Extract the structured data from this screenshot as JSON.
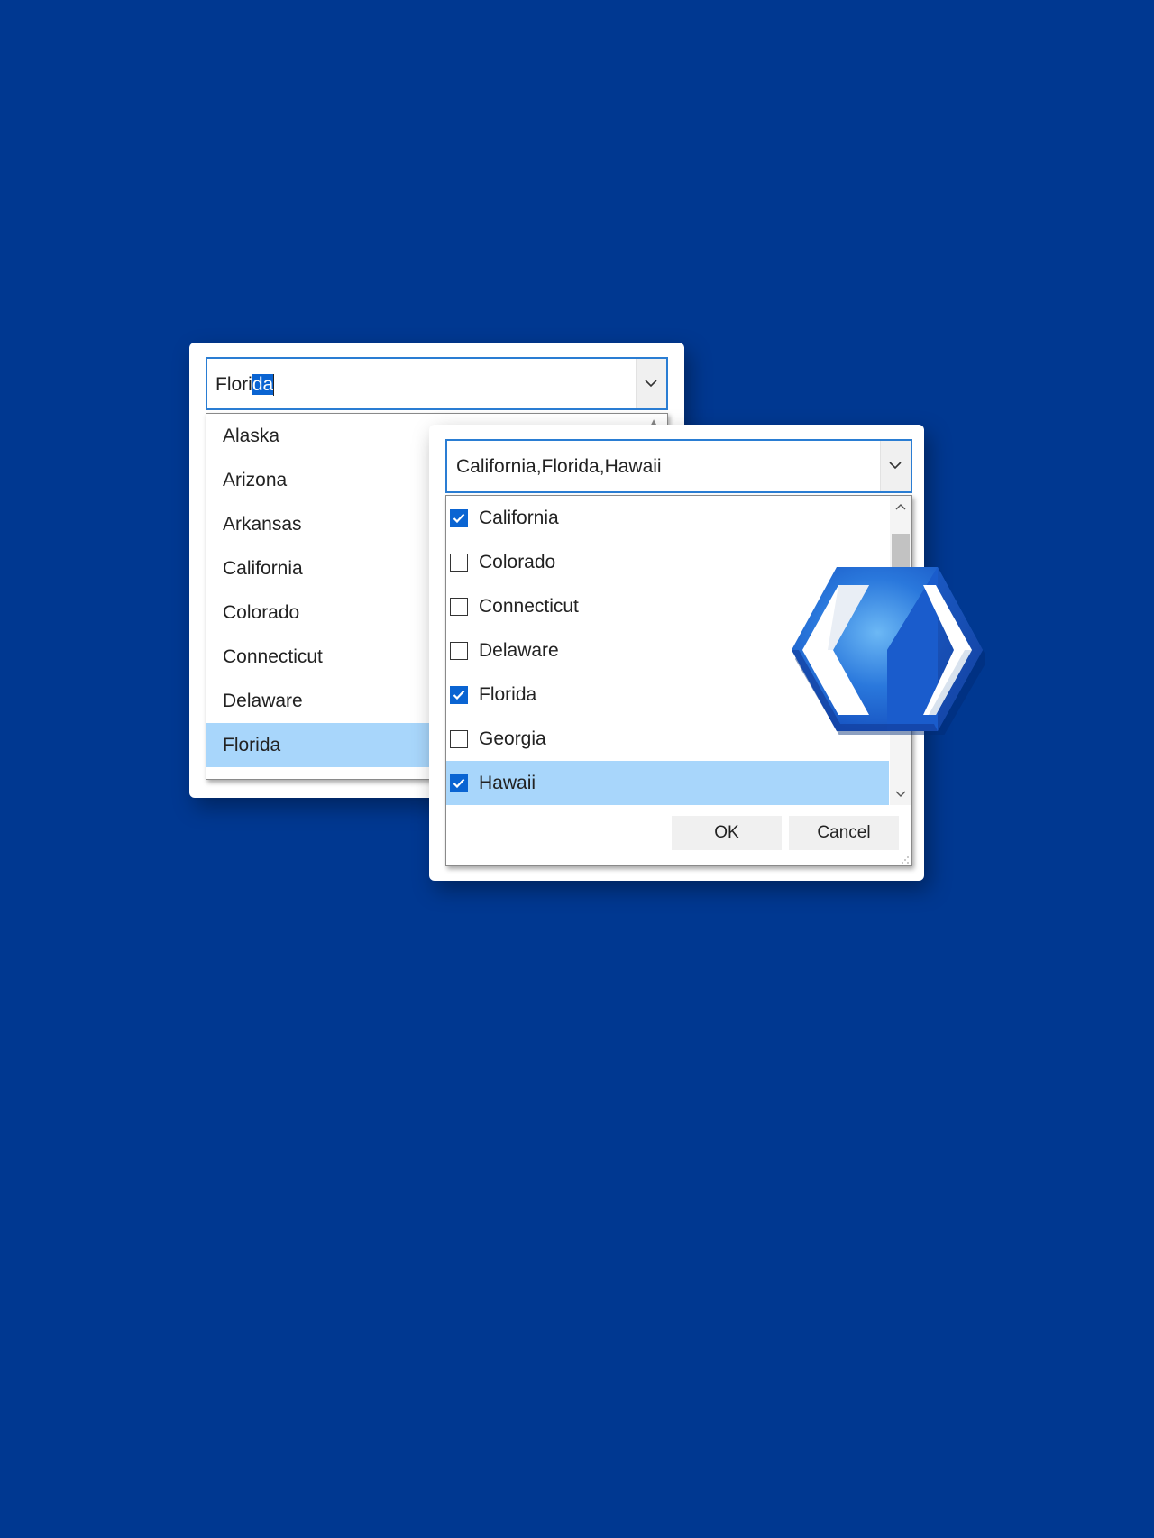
{
  "autocomplete_combo": {
    "typed_text": "Flori",
    "selected_text": "da",
    "items": [
      {
        "label": "Alaska",
        "selected": false
      },
      {
        "label": "Arizona",
        "selected": false
      },
      {
        "label": "Arkansas",
        "selected": false
      },
      {
        "label": "California",
        "selected": false
      },
      {
        "label": "Colorado",
        "selected": false
      },
      {
        "label": "Connecticut",
        "selected": false
      },
      {
        "label": "Delaware",
        "selected": false
      },
      {
        "label": "Florida",
        "selected": true
      }
    ]
  },
  "checked_combo": {
    "value": "California,Florida,Hawaii",
    "items": [
      {
        "label": "California",
        "checked": true,
        "selected": false
      },
      {
        "label": "Colorado",
        "checked": false,
        "selected": false
      },
      {
        "label": "Connecticut",
        "checked": false,
        "selected": false
      },
      {
        "label": "Delaware",
        "checked": false,
        "selected": false
      },
      {
        "label": "Florida",
        "checked": true,
        "selected": false
      },
      {
        "label": "Georgia",
        "checked": false,
        "selected": false
      },
      {
        "label": "Hawaii",
        "checked": true,
        "selected": true
      }
    ],
    "ok_label": "OK",
    "cancel_label": "Cancel"
  },
  "icons": {
    "dropdown": "chevron-down-icon",
    "checkbox": "check-icon",
    "logo": "code-brackets-cube-logo"
  },
  "colors": {
    "background": "#003891",
    "accent": "#0a64d2",
    "selection": "#a8d6fb",
    "focus_border": "#2a7dd3"
  }
}
